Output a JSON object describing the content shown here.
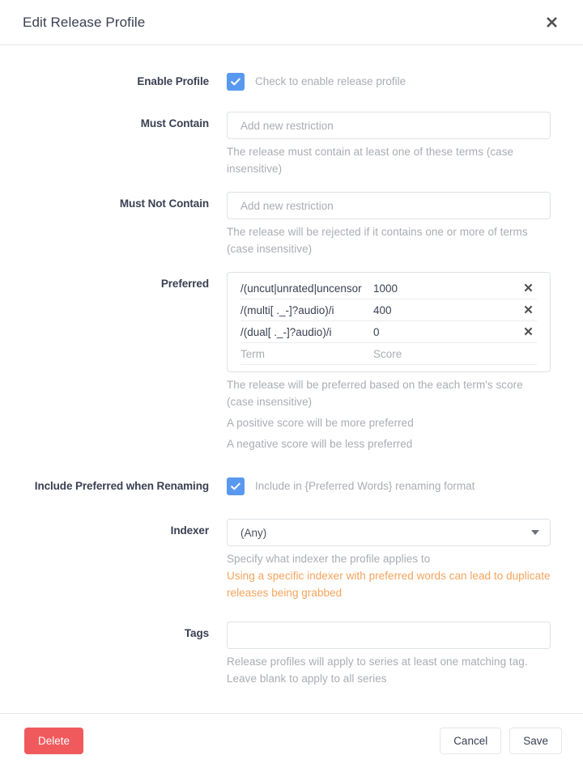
{
  "header": {
    "title": "Edit Release Profile",
    "close_icon": "close-icon"
  },
  "form": {
    "enable_profile": {
      "label": "Enable Profile",
      "checkbox_label": "Check to enable release profile",
      "checked": true
    },
    "must_contain": {
      "label": "Must Contain",
      "placeholder": "Add new restriction",
      "value": "",
      "help": "The release must contain at least one of these terms (case insensitive)"
    },
    "must_not_contain": {
      "label": "Must Not Contain",
      "placeholder": "Add new restriction",
      "value": "",
      "help": "The release will be rejected if it contains one or more of terms (case insensitive)"
    },
    "preferred": {
      "label": "Preferred",
      "rows": [
        {
          "term": "/(uncut|unrated|uncensor",
          "score": "1000",
          "remove_icon": "close-icon"
        },
        {
          "term": "/(multi[ ._-]?audio)/i",
          "score": "400",
          "remove_icon": "close-icon"
        },
        {
          "term": "/(dual[ ._-]?audio)/i",
          "score": "0",
          "remove_icon": "close-icon"
        }
      ],
      "new_row": {
        "term_placeholder": "Term",
        "score_placeholder": "Score"
      },
      "help_1": "The release will be preferred based on the each term's score (case insensitive)",
      "help_2": "A positive score will be more preferred",
      "help_3": "A negative score will be less preferred"
    },
    "include_preferred": {
      "label": "Include Preferred when Renaming",
      "checkbox_label": "Include in {Preferred Words} renaming format",
      "checked": true
    },
    "indexer": {
      "label": "Indexer",
      "value": "(Any)",
      "caret_icon": "chevron-down-icon",
      "help": "Specify what indexer the profile applies to",
      "warning": "Using a specific indexer with preferred words can lead to duplicate releases being grabbed"
    },
    "tags": {
      "label": "Tags",
      "placeholder": "",
      "value": "",
      "help": "Release profiles will apply to series at least one matching tag. Leave blank to apply to all series"
    }
  },
  "footer": {
    "delete_label": "Delete",
    "cancel_label": "Cancel",
    "save_label": "Save"
  },
  "colors": {
    "accent": "#5899ef",
    "danger": "#f05a5c",
    "warning": "#f6a35c",
    "text": "#3a3f51",
    "muted": "#a9adb3",
    "border": "#dde2e6"
  }
}
